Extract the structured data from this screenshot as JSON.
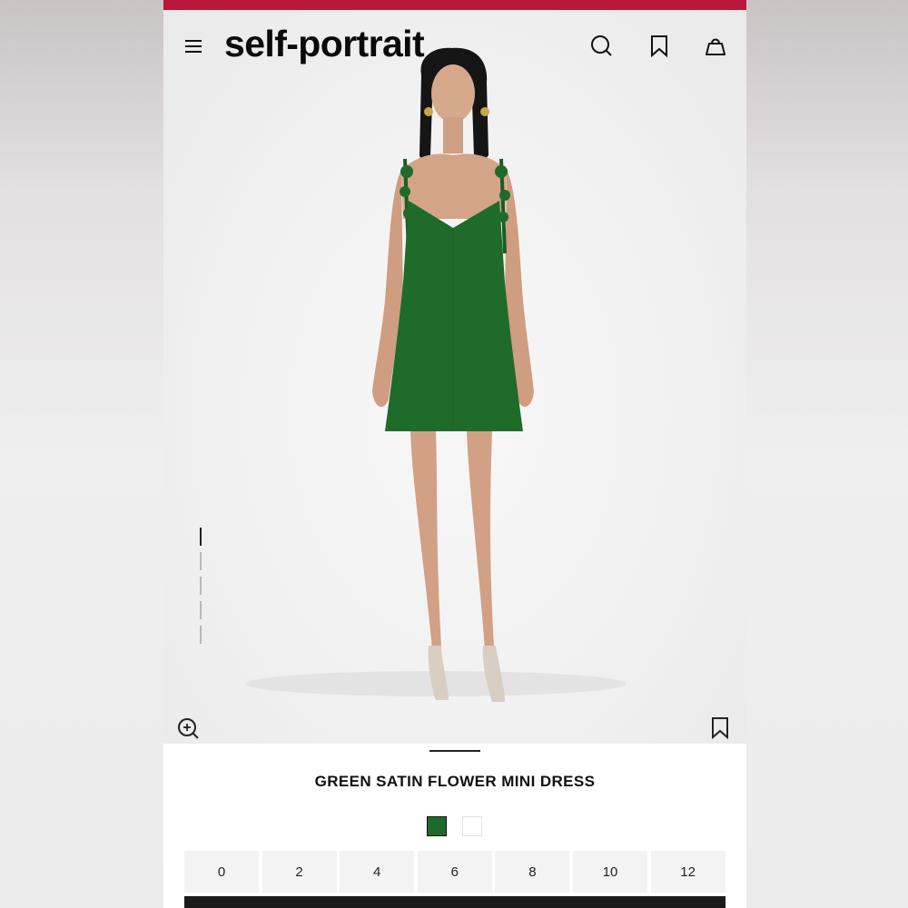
{
  "app": {
    "brand": "self-portrait",
    "accent_color": "#b8173a"
  },
  "header": {
    "menu_icon": "hamburger-menu-icon",
    "search_icon": "search-icon",
    "wishlist_icon": "bookmark-icon",
    "bag_icon": "shopping-bag-icon"
  },
  "gallery": {
    "image_count": 5,
    "active_index": 0,
    "zoom_icon": "zoom-in-icon",
    "save_icon": "bookmark-icon",
    "dress_color": "#1f6b2a"
  },
  "product": {
    "title": "GREEN SATIN FLOWER MINI DRESS",
    "colors": [
      {
        "name": "green",
        "hex": "#1e6a2c",
        "selected": true
      },
      {
        "name": "white",
        "hex": "#ffffff",
        "selected": false
      }
    ],
    "sizes": [
      "0",
      "2",
      "4",
      "6",
      "8",
      "10",
      "12"
    ]
  }
}
